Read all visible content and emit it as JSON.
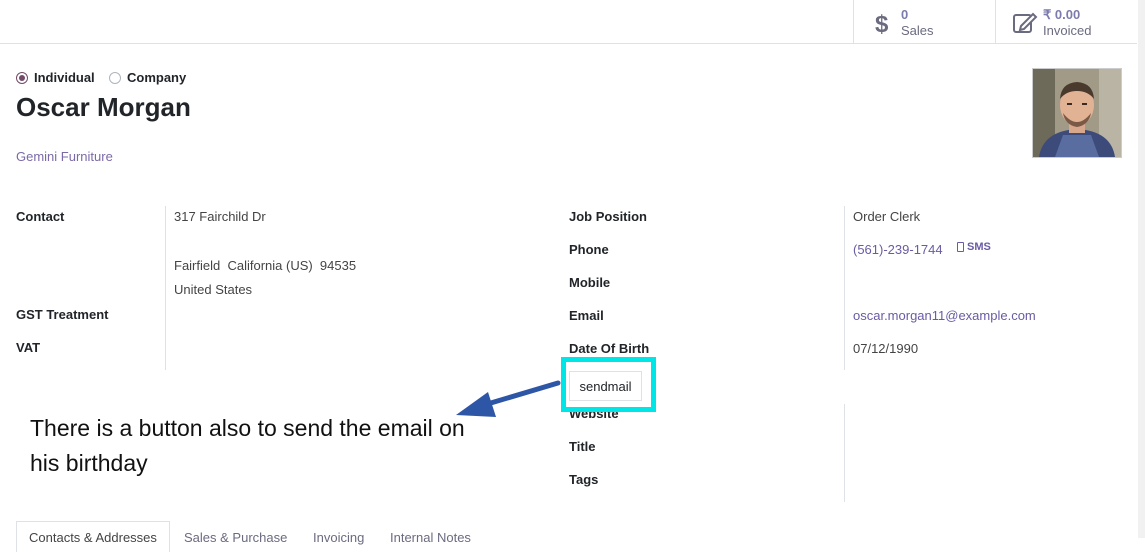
{
  "stats": {
    "sales": {
      "value": "0",
      "label": "Sales",
      "icon": "dollar-icon"
    },
    "invoiced": {
      "value": "₹ 0.00",
      "label": "Invoiced",
      "icon": "edit-invoice-icon"
    }
  },
  "partner_type": {
    "individual": "Individual",
    "company": "Company",
    "selected": "Individual"
  },
  "name": "Oscar Morgan",
  "company_name": "Gemini Furniture",
  "left_fields": {
    "contact_label": "Contact",
    "street": "317 Fairchild Dr",
    "city_line": "Fairfield  California (US)  94535",
    "country": "United States",
    "gst_label": "GST Treatment",
    "vat_label": "VAT"
  },
  "right_fields": {
    "job_position_label": "Job Position",
    "job_position_value": "Order Clerk",
    "phone_label": "Phone",
    "phone_value": "(561)-239-1744",
    "sms_label": "SMS",
    "mobile_label": "Mobile",
    "email_label": "Email",
    "email_value": "oscar.morgan11@example.com",
    "dob_label": "Date Of Birth",
    "dob_value": "07/12/1990",
    "website_label": "Website",
    "title_label": "Title",
    "tags_label": "Tags"
  },
  "sendmail_button": "sendmail",
  "annotation": "There is a button also to send the email on his birthday",
  "tabs": [
    "Contacts & Addresses",
    "Sales & Purchase",
    "Invoicing",
    "Internal Notes"
  ],
  "colors": {
    "accent": "#714b67",
    "link": "#6a5ba3",
    "highlight": "#00e5e5",
    "arrow": "#2e56a6"
  }
}
